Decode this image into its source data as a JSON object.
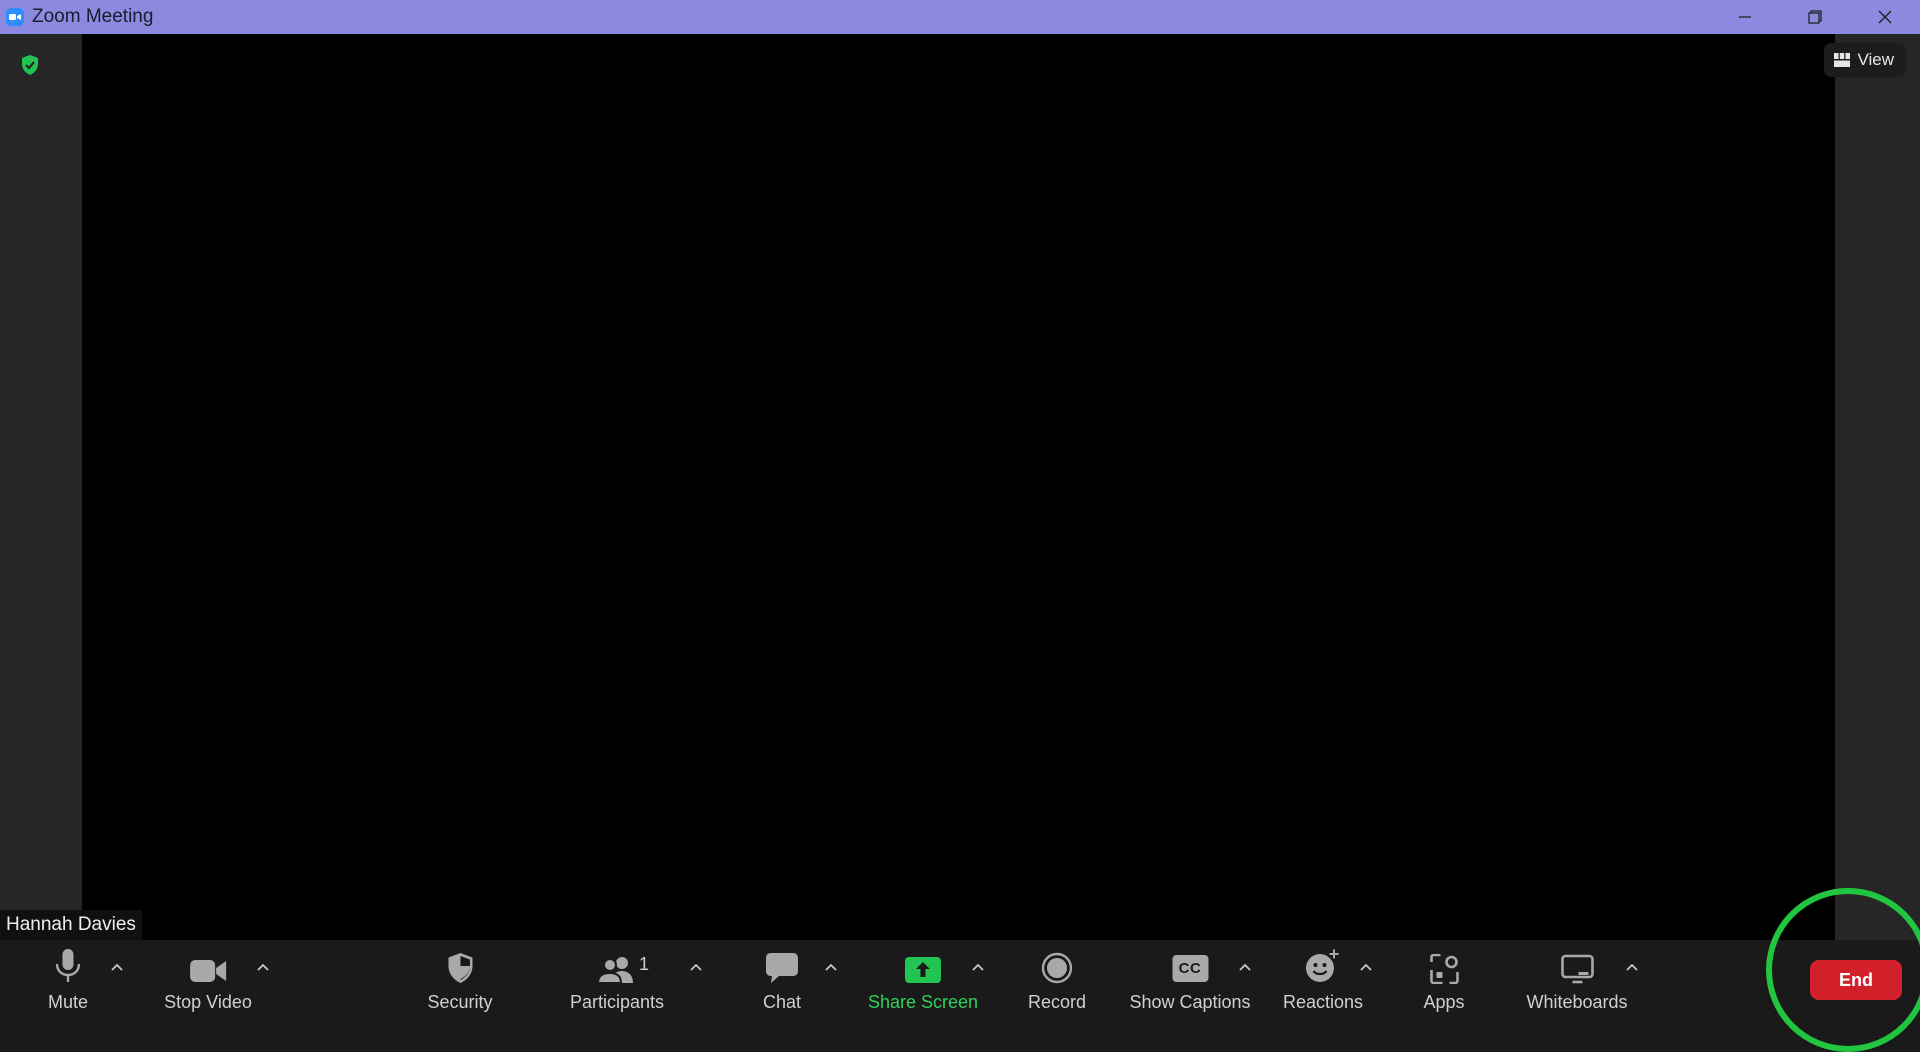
{
  "window": {
    "title": "Zoom Meeting",
    "icons": {
      "app": "zoom-camera-icon",
      "minimize": "minimize-icon",
      "restore": "restore-icon",
      "close": "close-icon"
    }
  },
  "meeting": {
    "participant_name": "Hannah Davies",
    "view_label": "View",
    "security_badge_icon": "shield-check-icon",
    "colors": {
      "titlebar": "#8c8ae0",
      "video_bg": "#000000",
      "side_bg": "#262626",
      "toolbar_bg": "#1a1a1a",
      "accent_green": "#2fd15a",
      "end_red": "#d2202b"
    }
  },
  "toolbar": {
    "mute": "Mute",
    "stop_video": "Stop Video",
    "security": "Security",
    "participants": "Participants",
    "participant_count": "1",
    "chat": "Chat",
    "share_screen": "Share Screen",
    "record": "Record",
    "show_captions": "Show Captions",
    "captions_badge": "CC",
    "reactions": "Reactions",
    "apps": "Apps",
    "whiteboards": "Whiteboards",
    "end": "End"
  }
}
